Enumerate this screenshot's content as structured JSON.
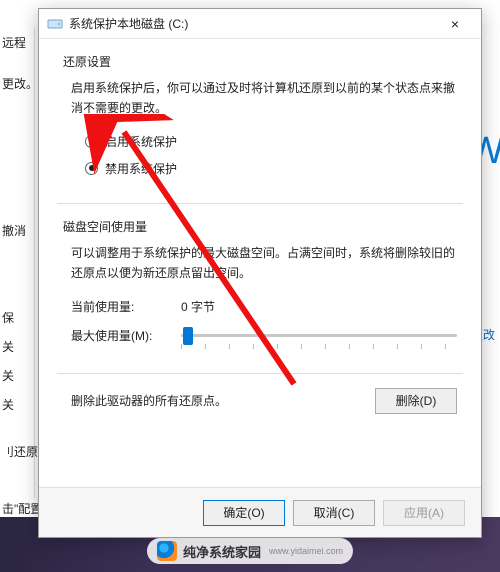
{
  "background": {
    "left_items": [
      "远程",
      "更改。",
      "",
      "",
      "",
      "",
      "",
      "",
      "",
      "",
      "",
      "",
      "撤消"
    ],
    "left_rows": [
      "保",
      "关",
      "关",
      "关"
    ],
    "left_rows2": [
      "刂还原"
    ],
    "left_rows3": [
      "击\"配置"
    ],
    "right_fragment": "OW",
    "change_link": "更改"
  },
  "dialog": {
    "title": "系统保护本地磁盘 (C:)",
    "close": "×",
    "restore": {
      "heading": "还原设置",
      "desc": "启用系统保护后，你可以通过及时将计算机还原到以前的某个状态点来撤消不需要的更改。",
      "opt_enable": "启用系统保护",
      "opt_disable": "禁用系统保护",
      "selected": "disable"
    },
    "disk": {
      "heading": "磁盘空间使用量",
      "desc": "可以调整用于系统保护的最大磁盘空间。占满空间时，系统将删除较旧的还原点以便为新还原点留出空间。",
      "current_label": "当前使用量:",
      "current_value": "0 字节",
      "max_label": "最大使用量(M):"
    },
    "delete": {
      "text": "删除此驱动器的所有还原点。",
      "button": "删除(D)"
    },
    "buttons": {
      "ok": "确定(O)",
      "cancel": "取消(C)",
      "apply": "应用(A)"
    }
  },
  "watermark": {
    "name": "纯净系统家园",
    "url": "www.yidaimei.com"
  }
}
